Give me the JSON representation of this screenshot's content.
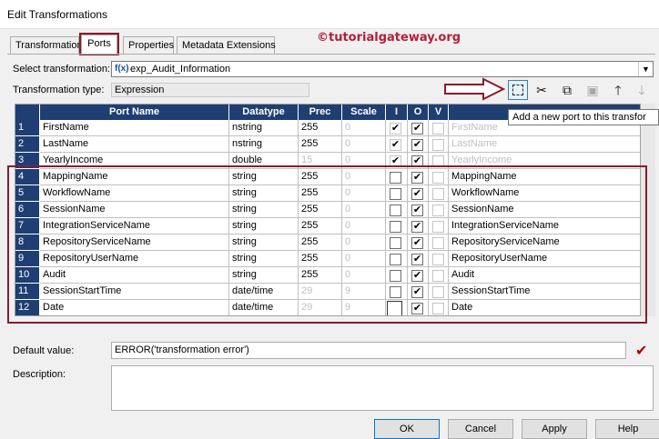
{
  "window": {
    "title": "Edit Transformations"
  },
  "tabs": [
    {
      "label": "Transformation"
    },
    {
      "label": "Ports"
    },
    {
      "label": "Properties"
    },
    {
      "label": "Metadata Extensions"
    }
  ],
  "watermark": "©tutorialgateway.org",
  "select_transformation": {
    "label": "Select transformation:",
    "value": "exp_Audit_Information",
    "glyph": "f(x)"
  },
  "transformation_type": {
    "label": "Transformation type:",
    "value": "Expression"
  },
  "tooltip": "Add a new port to this transfor",
  "grid": {
    "headers": [
      "Port Name",
      "Datatype",
      "Prec",
      "Scale",
      "I",
      "O",
      "V"
    ],
    "rows": [
      {
        "n": "1",
        "name": "FirstName",
        "type": "nstring",
        "prec": "255",
        "scale": "0",
        "i": true,
        "o": true,
        "v": false,
        "expr": "FirstName",
        "expr_muted": true,
        "prec_muted": false
      },
      {
        "n": "2",
        "name": "LastName",
        "type": "nstring",
        "prec": "255",
        "scale": "0",
        "i": true,
        "o": true,
        "v": false,
        "expr": "LastName",
        "expr_muted": true,
        "prec_muted": false
      },
      {
        "n": "3",
        "name": "YearlyIncome",
        "type": "double",
        "prec": "15",
        "scale": "0",
        "i": true,
        "o": true,
        "v": false,
        "expr": "YearlyIncome",
        "expr_muted": true,
        "prec_muted": true
      },
      {
        "n": "4",
        "name": "MappingName",
        "type": "string",
        "prec": "255",
        "scale": "0",
        "i": false,
        "o": true,
        "v": false,
        "expr": "MappingName",
        "expr_muted": false,
        "prec_muted": false
      },
      {
        "n": "5",
        "name": "WorkflowName",
        "type": "string",
        "prec": "255",
        "scale": "0",
        "i": false,
        "o": true,
        "v": false,
        "expr": "WorkflowName",
        "expr_muted": false,
        "prec_muted": false
      },
      {
        "n": "6",
        "name": "SessionName",
        "type": "string",
        "prec": "255",
        "scale": "0",
        "i": false,
        "o": true,
        "v": false,
        "expr": "SessionName",
        "expr_muted": false,
        "prec_muted": false
      },
      {
        "n": "7",
        "name": "IntegrationServiceName",
        "type": "string",
        "prec": "255",
        "scale": "0",
        "i": false,
        "o": true,
        "v": false,
        "expr": "IntegrationServiceName",
        "expr_muted": false,
        "prec_muted": false
      },
      {
        "n": "8",
        "name": "RepositoryServiceName",
        "type": "string",
        "prec": "255",
        "scale": "0",
        "i": false,
        "o": true,
        "v": false,
        "expr": "RepositoryServiceName",
        "expr_muted": false,
        "prec_muted": false
      },
      {
        "n": "9",
        "name": "RepositoryUserName",
        "type": "string",
        "prec": "255",
        "scale": "0",
        "i": false,
        "o": true,
        "v": false,
        "expr": "RepositoryUserName",
        "expr_muted": false,
        "prec_muted": false
      },
      {
        "n": "10",
        "name": "Audit",
        "type": "string",
        "prec": "255",
        "scale": "0",
        "i": false,
        "o": true,
        "v": false,
        "expr": "Audit",
        "expr_muted": false,
        "prec_muted": false
      },
      {
        "n": "11",
        "name": "SessionStartTime",
        "type": "date/time",
        "prec": "29",
        "scale": "9",
        "i": false,
        "o": true,
        "v": false,
        "expr": "SessionStartTime",
        "expr_muted": false,
        "prec_muted": true
      },
      {
        "n": "12",
        "name": "Date",
        "type": "date/time",
        "prec": "29",
        "scale": "9",
        "i": false,
        "o": true,
        "v": false,
        "expr": "Date",
        "expr_muted": false,
        "prec_muted": true
      }
    ]
  },
  "default_value": {
    "label": "Default value:",
    "value": "ERROR('transformation error')"
  },
  "description": {
    "label": "Description:",
    "value": ""
  },
  "buttons": {
    "ok": "OK",
    "cancel": "Cancel",
    "apply": "Apply",
    "help": "Help"
  },
  "toolbar_icons": [
    "new-port-icon",
    "cut-icon",
    "copy-icon",
    "paste-icon",
    "move-up-icon",
    "move-down-icon"
  ],
  "colors": {
    "header_bg": "#1f3f73",
    "annotation_red": "#8b1a2b",
    "watermark": "#b2203a"
  }
}
